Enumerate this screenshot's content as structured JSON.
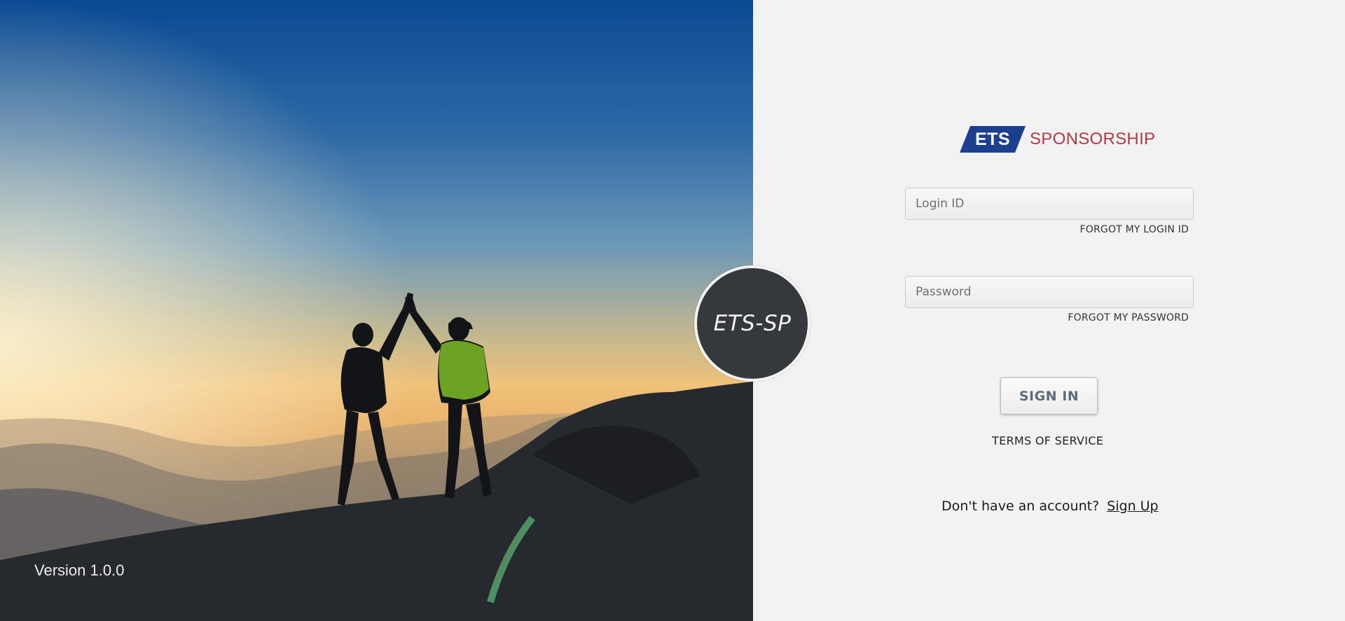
{
  "hero": {
    "version_text": "Version 1.0.0"
  },
  "emblem": {
    "text": "ETS-SP"
  },
  "logo": {
    "mark_text": "ETS",
    "brand_text": "SPONSORSHIP",
    "mark_color": "#1d3f8f",
    "brand_color": "#b23a48"
  },
  "form": {
    "login_placeholder": "Login ID",
    "login_value": "",
    "forgot_login_label": "FORGOT MY LOGIN ID",
    "password_placeholder": "Password",
    "password_value": "",
    "forgot_password_label": "FORGOT MY PASSWORD",
    "signin_label": "SIGN IN",
    "terms_label": "TERMS OF SERVICE",
    "no_account_text": "Don't have an account?",
    "signup_label": "Sign Up"
  }
}
